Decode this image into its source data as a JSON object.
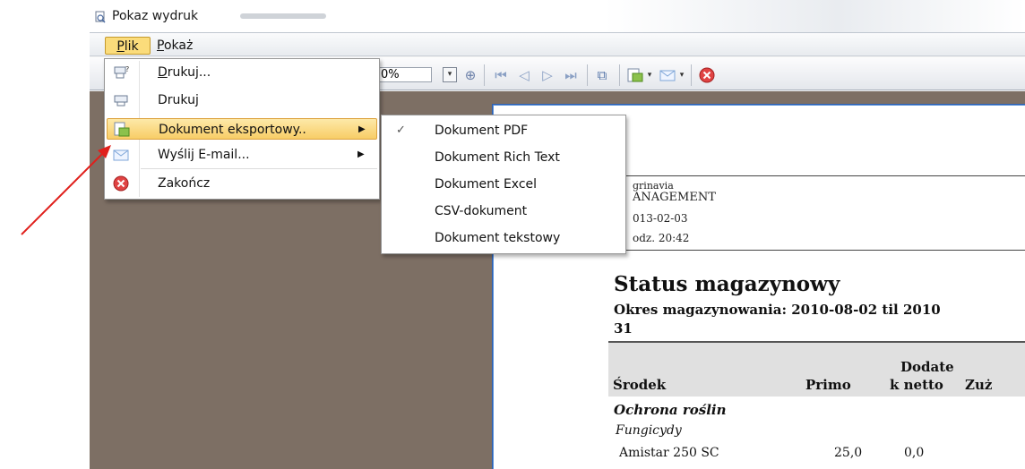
{
  "window": {
    "title": "Pokaz wydruk"
  },
  "menubar": {
    "plik": {
      "mnemonic": "P",
      "rest": "lik"
    },
    "pokaz": {
      "mnemonic": "P",
      "rest": "okaż"
    }
  },
  "toolbar": {
    "zoom_value": "0%",
    "icons": [
      "zoom-dropdown-icon",
      "zoom-in-icon",
      "first-page-icon",
      "prev-page-icon",
      "next-page-icon",
      "last-page-icon",
      "page-setup-icon",
      "export-icon",
      "email-icon",
      "close-icon"
    ]
  },
  "file_menu": {
    "items": [
      {
        "mnemonic": "D",
        "rest": "rukuj...",
        "icon": "print-dialog-icon"
      },
      {
        "label": "Drukuj",
        "icon": "print-icon"
      },
      {
        "label": "Dokument eksportowy..",
        "icon": "export-icon",
        "submenu": true
      },
      {
        "label": "Wyślij E-mail...",
        "icon": "email-icon",
        "submenu": true
      },
      {
        "label": "Zakończ",
        "icon": "exit-icon"
      }
    ]
  },
  "export_submenu": {
    "items": [
      {
        "label": "Dokument PDF",
        "checked": true
      },
      {
        "label": "Dokument Rich Text"
      },
      {
        "label": "Dokument Excel"
      },
      {
        "label": "CSV-dokument"
      },
      {
        "label": "Dokument tekstowy"
      }
    ]
  },
  "report": {
    "header_lines": [
      "grinavia",
      "ANAGEMENT",
      "013-02-03",
      "odz. 20:42"
    ],
    "title": "Status magazynowy",
    "subtitle": "Okres magazynowania: 2010-08-02 til 2010",
    "subtitle_cont": "31",
    "columns": {
      "srodek": "Środek",
      "primo": "Primo",
      "dodatek_top": "Dodate",
      "dodatek_bottom": "k netto",
      "zuzycie": "Zuż"
    },
    "group": "Ochrona roślin",
    "subgroup": "Fungicydy",
    "rows": [
      {
        "name": "Amistar 250 SC",
        "primo": "25,0",
        "dodatek": "0,0"
      }
    ]
  },
  "colors": {
    "highlight": "#f8cd66",
    "content_bg": "#7d6f64",
    "annotation_arrow": "#e0201c"
  }
}
